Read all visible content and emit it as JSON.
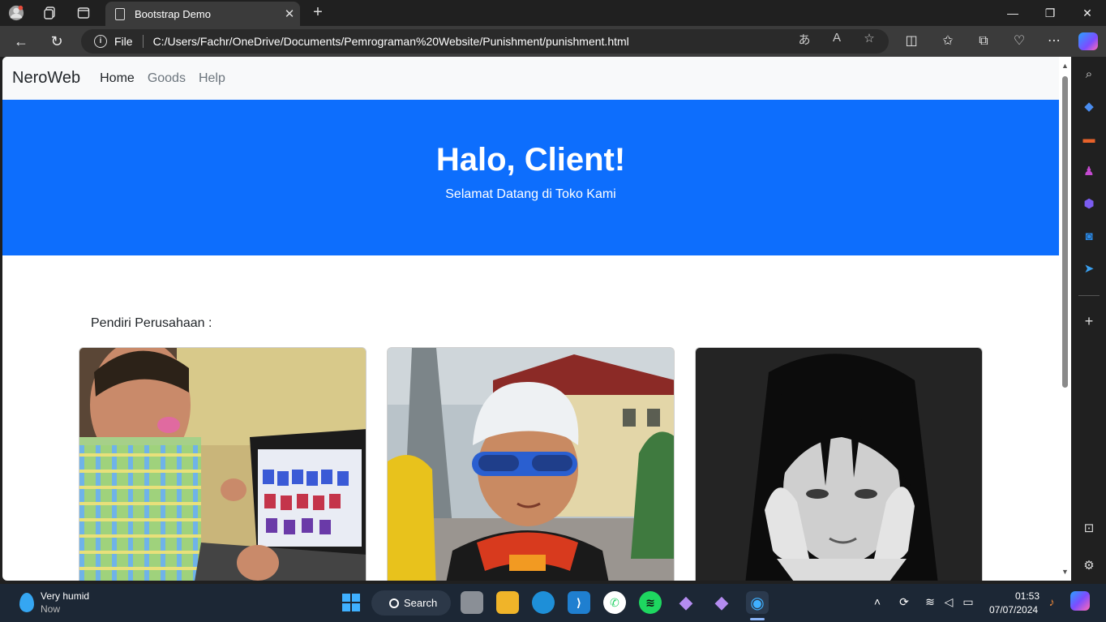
{
  "browser": {
    "tab_title": "Bootstrap Demo",
    "tab_close": "✕",
    "new_tab": "+",
    "file_label": "File",
    "url": "C:/Users/Fachr/OneDrive/Documents/Pemrograman%20Website/Punishment/punishment.html"
  },
  "page": {
    "brand": "NeroWeb",
    "nav": [
      {
        "label": "Home"
      },
      {
        "label": "Goods"
      },
      {
        "label": "Help"
      }
    ],
    "hero_title": "Halo, Client!",
    "hero_subtitle": "Selamat Datang di Toko Kami",
    "founders_label": "Pendiri Perusahaan :"
  },
  "taskbar": {
    "weather_title": "Very humid",
    "weather_sub": "Now",
    "search_label": "Search",
    "time": "01:53",
    "date": "07/07/2024"
  },
  "colors": {
    "hero_bg": "#0d6efd",
    "navbar_bg": "#f8f9fa",
    "chrome_dark": "#202020",
    "taskbar": "#1c2735"
  }
}
